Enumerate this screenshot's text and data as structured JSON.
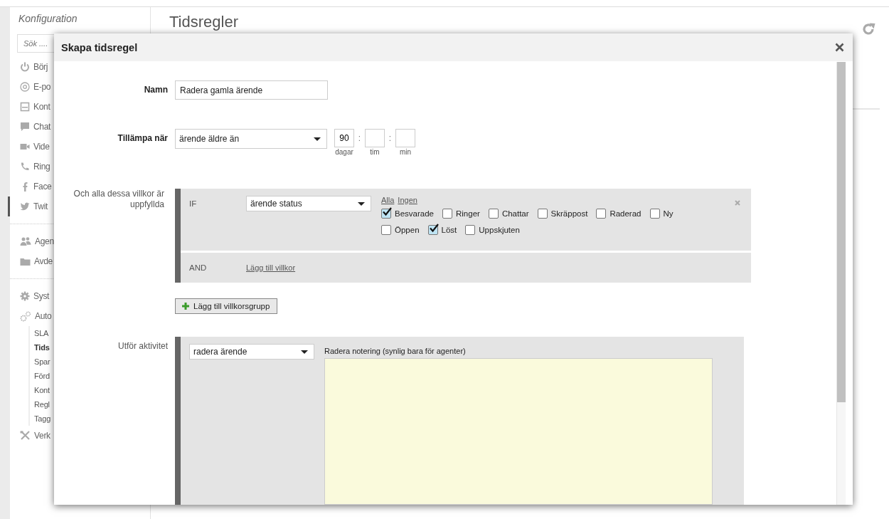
{
  "sidebar": {
    "title": "Konfiguration",
    "search": {
      "placeholder": "Sök ...."
    },
    "groups": [
      {
        "items": [
          {
            "label": "Börj",
            "selected": false
          },
          {
            "label": "E-po",
            "selected": false
          },
          {
            "label": "Kont",
            "selected": false
          },
          {
            "label": "Chat",
            "selected": false
          },
          {
            "label": "Vide",
            "selected": false
          },
          {
            "label": "Ring",
            "selected": false
          },
          {
            "label": "Face",
            "selected": false
          },
          {
            "label": "Twit",
            "selected": true
          }
        ]
      },
      {
        "items": [
          {
            "label": "Agen",
            "selected": false
          },
          {
            "label": "Avde",
            "selected": false
          }
        ]
      },
      {
        "items": [
          {
            "label": "Syst",
            "selected": false
          },
          {
            "label": "Auto",
            "selected": false,
            "children": [
              {
                "label": "SLA",
                "selected": false
              },
              {
                "label": "Tids",
                "selected": true
              },
              {
                "label": "Spar",
                "selected": false
              },
              {
                "label": "Förd",
                "selected": false
              },
              {
                "label": "Kont",
                "selected": false
              },
              {
                "label": "Regl",
                "selected": false
              },
              {
                "label": "Tagg",
                "selected": false
              }
            ]
          },
          {
            "label": "Verk",
            "selected": false
          }
        ]
      }
    ]
  },
  "page": {
    "title": "Tidsregler"
  },
  "dialog": {
    "title": "Skapa tidsregel",
    "name": {
      "label": "Namn",
      "value": "Radera gamla ärende"
    },
    "apply_when": {
      "label": "Tillämpa när",
      "value": "ärende äldre än",
      "parts": [
        {
          "value": "90",
          "unit": "dagar"
        },
        {
          "separator": ":",
          "unit": "tim"
        },
        {
          "separator": ":",
          "unit": "min"
        }
      ]
    },
    "conditions": {
      "label": "Och alla dessa villkor är uppfyllda",
      "if_label": "IF",
      "field": "ärende status",
      "all_link": "Alla",
      "none_link": "Ingen",
      "options": [
        {
          "label": "Besvarade",
          "checked": true
        },
        {
          "label": "Ringer",
          "checked": false
        },
        {
          "label": "Chattar",
          "checked": false
        },
        {
          "label": "Skräppost",
          "checked": false
        },
        {
          "label": "Raderad",
          "checked": false
        },
        {
          "label": "Ny",
          "checked": false
        },
        {
          "label": "Öppen",
          "checked": false
        },
        {
          "label": "Löst",
          "checked": true
        },
        {
          "label": "Uppskjuten",
          "checked": false
        }
      ],
      "and_label": "AND",
      "add_condition": "Lägg till villkor",
      "add_group": "Lägg till villkorsgrupp"
    },
    "action": {
      "label": "Utför aktivitet",
      "value": "radera ärende",
      "note_label": "Radera notering (synlig bara för agenter)"
    }
  }
}
